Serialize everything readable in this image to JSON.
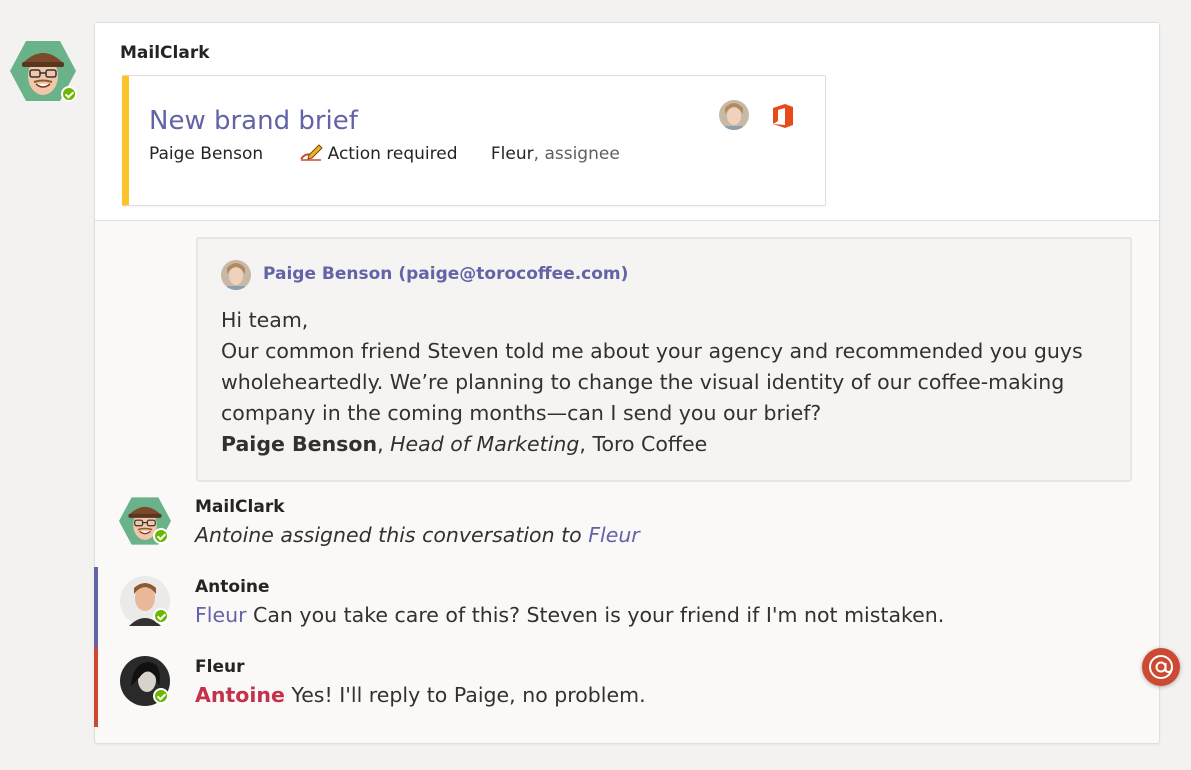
{
  "bot": {
    "name": "MailClark"
  },
  "card": {
    "title": "New brand brief",
    "from": "Paige Benson",
    "status": "Action required",
    "assignee_name": "Fleur",
    "assignee_role": ", assignee"
  },
  "email": {
    "from": "Paige Benson (paige@torocoffee.com)",
    "greeting": "Hi team,",
    "body": "Our common friend Steven told me about your agency and recommended you guys wholeheartedly. We’re planning to change the visual identity of our coffee-making company in the coming months—can I send you our brief?",
    "signature_name": "Paige Benson",
    "signature_sep1": ", ",
    "signature_title": "Head of Marketing",
    "signature_sep2": ", Toro Coffee"
  },
  "messages": [
    {
      "author": "MailClark",
      "text_prefix": "Antoine assigned this conversation to ",
      "mention": "Fleur"
    },
    {
      "author": "Antoine",
      "mention": "Fleur",
      "text": " Can you take care of this? Steven is your friend if I'm not mistaken.",
      "accent": "#6264a7"
    },
    {
      "author": "Fleur",
      "mention": "Antoine",
      "text": " Yes! I'll reply to Paige, no problem.",
      "accent": "#cc4a31"
    }
  ],
  "icons": {
    "office": "office-icon",
    "mention_button": "at-sign-icon",
    "action": "pen-icon"
  },
  "colors": {
    "brand": "#6264a7",
    "card_accent": "#fcc32b",
    "presence": "#6bb700",
    "urgent": "#cc4a31"
  }
}
